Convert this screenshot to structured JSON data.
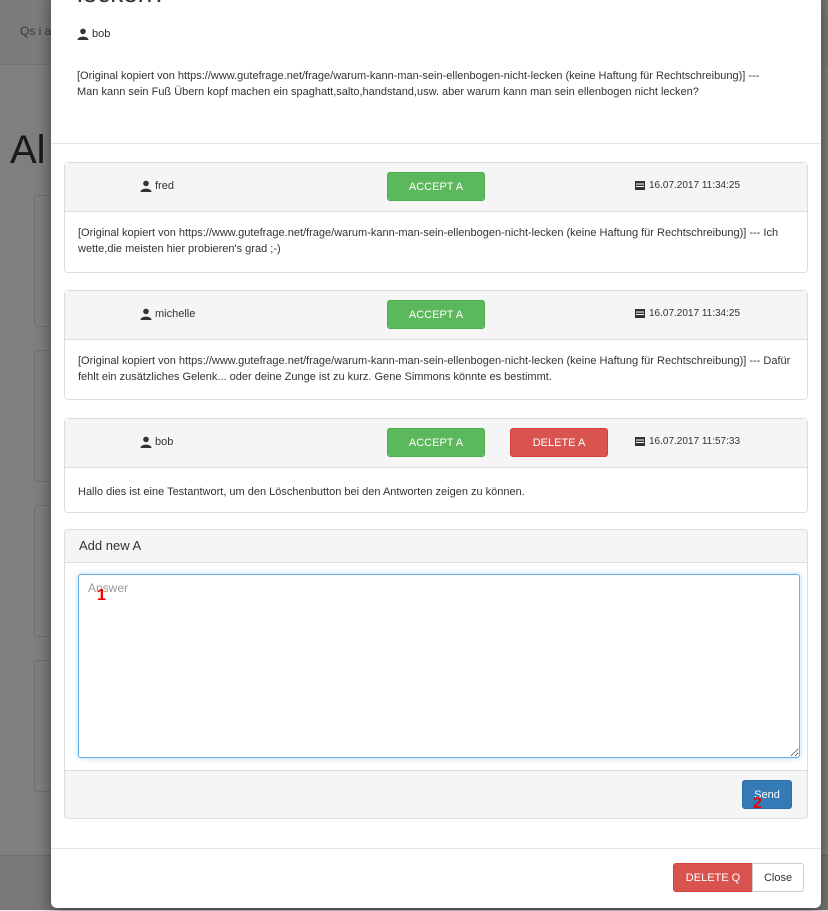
{
  "background": {
    "nav_link": "Qs i a",
    "heading": "Al"
  },
  "question": {
    "title": "lecken?",
    "author": "bob",
    "text": "[Original kopiert von https://www.gutefrage.net/frage/warum-kann-man-sein-ellenbogen-nicht-lecken (keine Haftung für Rechtschreibung)] --- Man kann sein Fuß Übern kopf machen ein spaghatt,salto,handstand,usw. aber warum kann man sein ellenbogen nicht lecken?"
  },
  "answers": [
    {
      "user": "fred",
      "accept_label": "ACCEPT A",
      "date": "16.07.2017 11:34:25",
      "text": "[Original kopiert von https://www.gutefrage.net/frage/warum-kann-man-sein-ellenbogen-nicht-lecken (keine Haftung für Rechtschreibung)] --- Ich wette,die meisten hier probieren's grad ;-)"
    },
    {
      "user": "michelle",
      "accept_label": "ACCEPT A",
      "date": "16.07.2017 11:34:25",
      "text": "[Original kopiert von https://www.gutefrage.net/frage/warum-kann-man-sein-ellenbogen-nicht-lecken (keine Haftung für Rechtschreibung)] --- Dafür fehlt ein zusätzliches Gelenk... oder deine Zunge ist zu kurz. Gene Simmons könnte es bestimmt."
    },
    {
      "user": "bob",
      "accept_label": "ACCEPT A",
      "delete_label": "DELETE A",
      "date": "16.07.2017 11:57:33",
      "text": "Hallo dies ist eine Testantwort, um den Löschenbutton bei den Antworten zeigen zu können."
    }
  ],
  "add_answer": {
    "heading": "Add new A",
    "placeholder": "Answer",
    "send_label": "Send"
  },
  "footer": {
    "delete_q_label": "DELETE Q",
    "close_label": "Close"
  },
  "annotations": {
    "marker_1": "1",
    "marker_2": "2"
  },
  "colors": {
    "success": "#5cb85c",
    "danger": "#d9534f",
    "primary": "#337ab7",
    "annotation": "#ee0000"
  },
  "icons": {
    "user": "user-icon",
    "calendar": "calendar-icon"
  }
}
